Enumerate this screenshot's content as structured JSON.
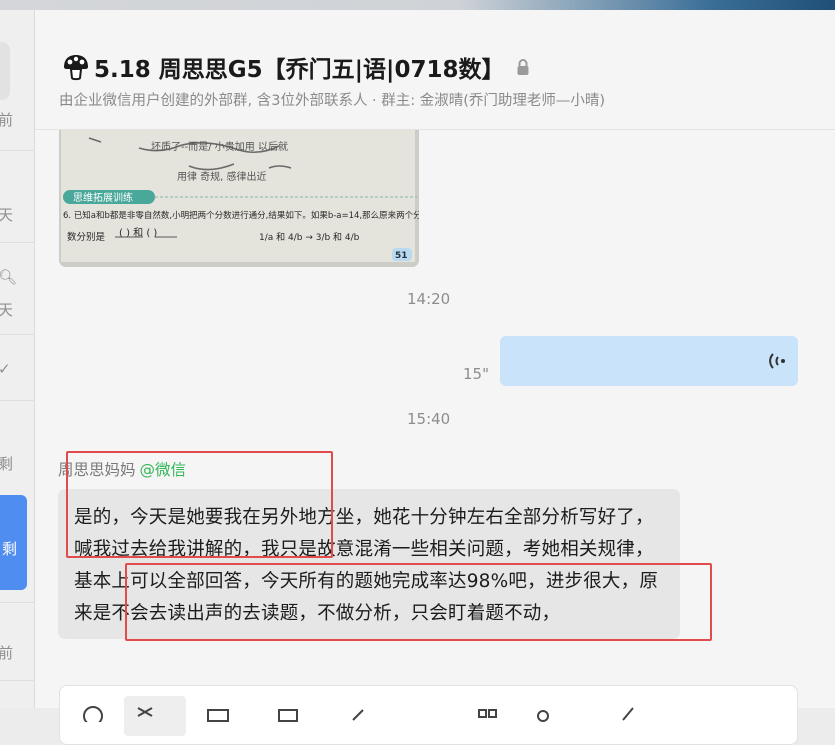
{
  "sidebar": {
    "fragments": [
      "前",
      "天",
      "天",
      "剩",
      "剩",
      "前"
    ],
    "active_fragment": "剩"
  },
  "header": {
    "title": "5.18 周思思G5【乔门五|语|0718数】",
    "subtitle": "由企业微信用户创建的外部群, 含3位外部联系人 · 群主: 金淑晴(乔门助理老师—小晴)"
  },
  "messages": {
    "image": {
      "line1": "6. 已知a和b都是非零自然数,小明把两个分数进行通分,结果如下。如果b-a=14,那么原来两个分",
      "line2": "数分别是",
      "page": "51",
      "badge": "思维拓展训练"
    },
    "time1": "14:20",
    "voice_duration": "15\"",
    "time2": "15:40",
    "sender_name": "周思思妈妈",
    "sender_source": "@微信",
    "body": "是的，今天是她要我在另外地方坐，她花十分钟左右全部分析写好了，喊我过去给我讲解的，我只是故意混淆一些相关问题，考她相关规律，基本上可以全部回答，今天所有的题她完成率达98%吧，进步很大，原来是不会去读出声的去读题，不做分析，只会盯着题不动，"
  },
  "colors": {
    "accent": "#4f8df0",
    "voice_bubble": "#c9e3fb",
    "wechat_green": "#34b65a",
    "annotation_red": "#e24b4b"
  }
}
